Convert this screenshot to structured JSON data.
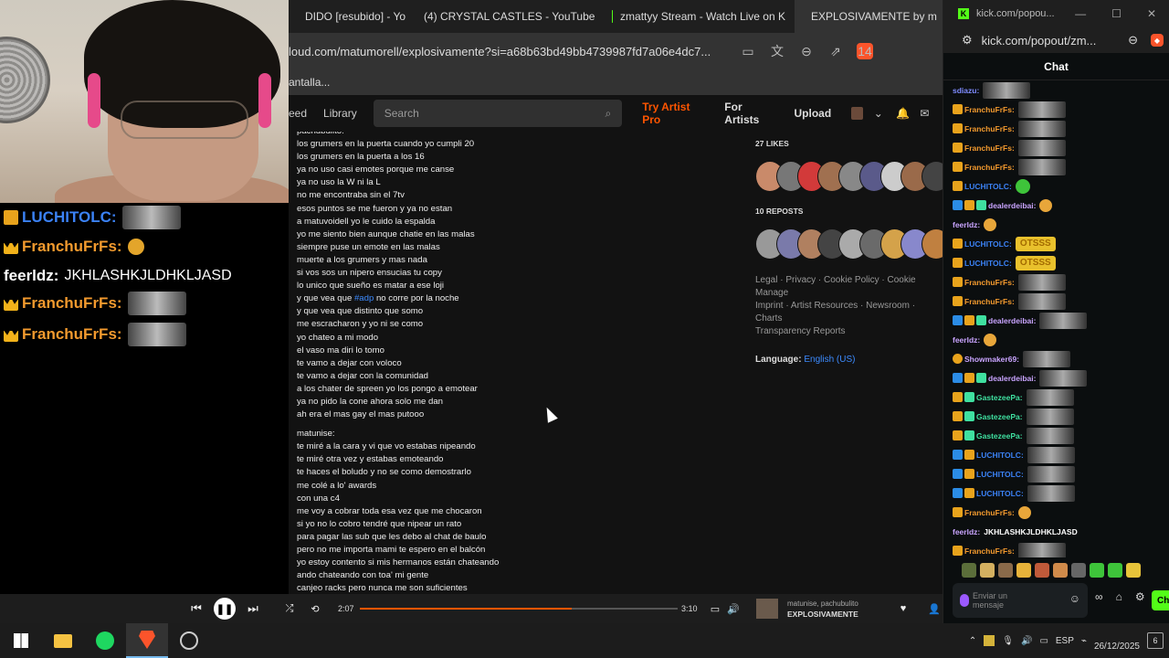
{
  "browser": {
    "tabs": [
      {
        "label": "DIDO [resubido] - Yo",
        "icon_color": "#ff4d4d"
      },
      {
        "label": "(4) CRYSTAL CASTLES - YouTube",
        "icon_color": "#ff0000"
      },
      {
        "label": "zmattyy Stream - Watch Live on K",
        "icon_color": "#53fc18"
      },
      {
        "label": "EXPLOSIVAMENTE by m",
        "icon_color": "#ff5500"
      }
    ],
    "url": "loud.com/matumorell/explosivamente?si=a68b63bd49bb4739987fd7a06e4dc7...",
    "bookmark": "antalla...",
    "brave_badge": "14"
  },
  "soundcloud": {
    "nav": [
      "eed",
      "Library"
    ],
    "search_placeholder": "Search",
    "try_pro": "Try Artist Pro",
    "for_artists": "For Artists",
    "upload": "Upload"
  },
  "lyrics": {
    "header": "pachubulito:",
    "section1": [
      "los grumers en la puerta cuando yo cumpli 20",
      "los grumers en la puerta a los 16",
      "ya no uso casi emotes porque me canse",
      "ya no uso la W ni la L",
      "no me encontraba sin el 7tv",
      "esos puntos se me fueron y ya no estan",
      "a matuvoidell yo le cuido la espalda",
      "yo me siento bien aunque chatie en las malas",
      "siempre puse un emote en las malas",
      "muerte a los grumers y mas nada",
      "si vos sos un nipero ensucias tu copy",
      "lo unico que sueño es matar a ese loji"
    ],
    "hashtag_prefix": "y que vea que ",
    "hashtag": "#adp",
    "hashtag_suffix": " no corre por la noche",
    "section1b": [
      "y que vea que distinto que somo",
      "me escracharon y yo ni se como",
      "yo chateo a mi modo",
      "el vaso ma diri lo tomo",
      "te vamo a dejar con voloco",
      "te vamo a dejar con la comunidad",
      "a los chater de spreen yo los pongo a emotear",
      "ya no pido la cone ahora solo me dan",
      "ah era el mas gay el mas putooo"
    ],
    "header2": "matunise:",
    "section2": [
      "te miré a la cara y vi que vo estabas nipeando",
      "te miré otra vez y estabas emoteando",
      "te haces el boludo y no se como demostrarlo",
      "me colé a lo' awards",
      "con una c4",
      "me voy a cobrar toda esa vez que me chocaron",
      "si yo no lo cobro tendré que nipear un rato",
      "para pagar las sub que les debo al chat de baulo",
      "pero no me importa mami te espero en el balcón",
      "yo estoy contento si mis hermanos están chateando",
      "ando chateando con toa' mi gente",
      "canjeo racks pero nunca me son suficientes"
    ]
  },
  "sidebar": {
    "likes": "27 LIKES",
    "reposts": "10 REPOSTS",
    "like_colors": [
      "#c98a6a",
      "#777",
      "#d23a3a",
      "#a07050",
      "#888",
      "#5a5a8a",
      "#ccc",
      "#9a6a4a",
      "#444"
    ],
    "repost_colors": [
      "#999",
      "#7a7aaa",
      "#b08060",
      "#444",
      "#aaa",
      "#6a6a6a",
      "#d4a24a",
      "#8888cc",
      "#c08040"
    ],
    "footer_lines": [
      "Legal · Privacy · Cookie Policy · Cookie Manage",
      "Imprint · Artist Resources · Newsroom · Charts",
      "Transparency Reports"
    ],
    "language_label": "Language:",
    "language_value": "English (US)"
  },
  "player": {
    "elapsed": "2:07",
    "duration": "3:10",
    "progress": 0.668,
    "artist": "matunise, pachubulito",
    "title": "EXPLOSIVAMENTE"
  },
  "left_chat": [
    {
      "user": "LUCHITOLC:",
      "color": "#3b82f6",
      "badge": "orange",
      "content": "emote"
    },
    {
      "user": "FranchuFrFs:",
      "color": "#f39a2e",
      "badge": "crown",
      "content": "small"
    },
    {
      "user": "feerldz:",
      "color": "#ffffff",
      "badge": "",
      "text": "JKHLASHKJLDHKLJASD"
    },
    {
      "user": "FranchuFrFs:",
      "color": "#f39a2e",
      "badge": "crown",
      "content": "emote"
    },
    {
      "user": "FranchuFrFs:",
      "color": "#f39a2e",
      "badge": "crown",
      "content": "emote"
    }
  ],
  "kick": {
    "window_url": "kick.com/popou...",
    "address": "kick.com/popout/zm...",
    "chat_title": "Chat",
    "input_placeholder": "Enviar un mensaje",
    "send_label": "Ch",
    "messages": [
      {
        "user": "sdiazu:",
        "color": "#7f8cff",
        "content": "emote"
      },
      {
        "user": "FranchuFrFs:",
        "color": "#f39a2e",
        "content": "emote"
      },
      {
        "user": "FranchuFrFs:",
        "color": "#f39a2e",
        "content": "emote"
      },
      {
        "user": "FranchuFrFs:",
        "color": "#f39a2e",
        "content": "emote"
      },
      {
        "user": "FranchuFrFs:",
        "color": "#f39a2e",
        "content": "emote"
      },
      {
        "user": "LUCHITOLC:",
        "color": "#3b82f6",
        "content": "smile"
      },
      {
        "user": "dealerdeibai:",
        "color": "#c9a4ff",
        "content": "face"
      },
      {
        "user": "feerldz:",
        "color": "#c9a4ff",
        "content": "face"
      },
      {
        "user": "LUCHITOLC:",
        "color": "#3b82f6",
        "content": "text_emote",
        "emote_text": "OTSSS"
      },
      {
        "user": "LUCHITOLC:",
        "color": "#3b82f6",
        "content": "text_emote",
        "emote_text": "OTSSS"
      },
      {
        "user": "FranchuFrFs:",
        "color": "#f39a2e",
        "content": "emote"
      },
      {
        "user": "FranchuFrFs:",
        "color": "#f39a2e",
        "content": "emote"
      },
      {
        "user": "dealerdeibai:",
        "color": "#c9a4ff",
        "content": "emote"
      },
      {
        "user": "feerldz:",
        "color": "#c9a4ff",
        "content": "face"
      },
      {
        "user": "Showmaker69:",
        "color": "#c9a4ff",
        "content": "emote"
      },
      {
        "user": "dealerdeibai:",
        "color": "#c9a4ff",
        "content": "emote"
      },
      {
        "user": "GastezeePa:",
        "color": "#3fe0a0",
        "content": "emote"
      },
      {
        "user": "GastezeePa:",
        "color": "#3fe0a0",
        "content": "emote"
      },
      {
        "user": "GastezeePa:",
        "color": "#3fe0a0",
        "content": "emote"
      },
      {
        "user": "LUCHITOLC:",
        "color": "#3b82f6",
        "content": "emote"
      },
      {
        "user": "LUCHITOLC:",
        "color": "#3b82f6",
        "content": "emote"
      },
      {
        "user": "LUCHITOLC:",
        "color": "#3b82f6",
        "content": "emote"
      },
      {
        "user": "FranchuFrFs:",
        "color": "#f39a2e",
        "content": "face"
      },
      {
        "user": "feerldz:",
        "color": "#c9a4ff",
        "content": "text",
        "text": "JKHLASHKJLDHKLJASD"
      },
      {
        "user": "FranchuFrFs:",
        "color": "#f39a2e",
        "content": "emote"
      }
    ]
  },
  "taskbar": {
    "lang": "ESP",
    "date": "26/12/2025",
    "notif_count": "6"
  }
}
